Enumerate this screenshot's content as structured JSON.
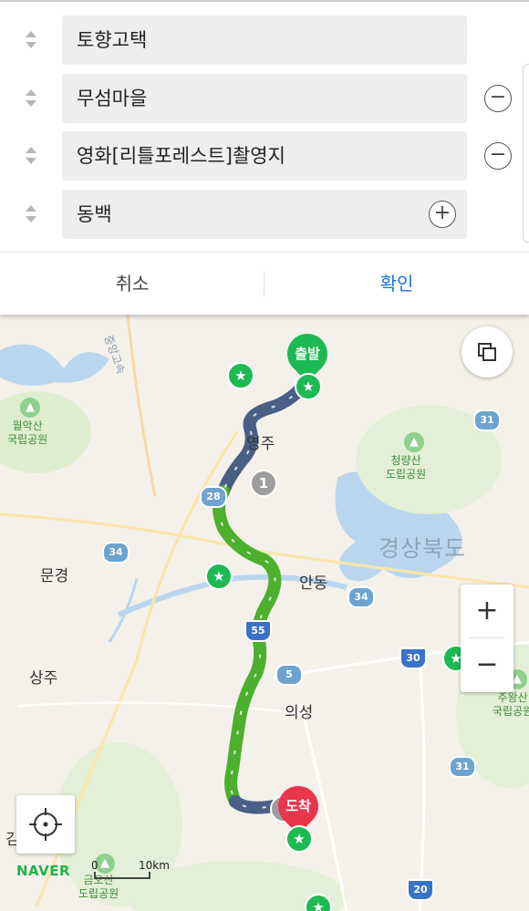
{
  "route_form": {
    "waypoints": [
      {
        "value": "토향고택",
        "action": ""
      },
      {
        "value": "무섬마을",
        "action": "−"
      },
      {
        "value": "영화[리틀포레스트]촬영지",
        "action": "−"
      },
      {
        "value": "동백",
        "action": "+"
      }
    ],
    "cancel_label": "취소",
    "confirm_label": "확인"
  },
  "map": {
    "labels": {
      "start": "출발",
      "end": "도착",
      "waypoint_number": "1",
      "yeongju": "영주",
      "andong": "안동",
      "mungyeong": "문경",
      "sangju": "상주",
      "uiseong": "의성",
      "gyeongbuk": "경상북도",
      "woraksan": "월악산\n국립공원",
      "cheongnyangsan": "청량산\n도립공원",
      "juwangsan": "주왕산\n국립공원",
      "geumosan": "금오산\n도립공원",
      "gim_partial": "김",
      "road_name": "중앙고속",
      "brand": "NAVER"
    },
    "highways": [
      "28",
      "34",
      "34",
      "31",
      "31",
      "55",
      "5",
      "30",
      "20"
    ],
    "scale": {
      "start": "0",
      "end": "10km"
    },
    "zoom_in": "+",
    "zoom_out": "−",
    "colors": {
      "route_green": "#4caf2e",
      "route_navy": "#4a5f86",
      "start": "#1db954",
      "end": "#e8364c",
      "accent": "#1a73e8"
    }
  }
}
